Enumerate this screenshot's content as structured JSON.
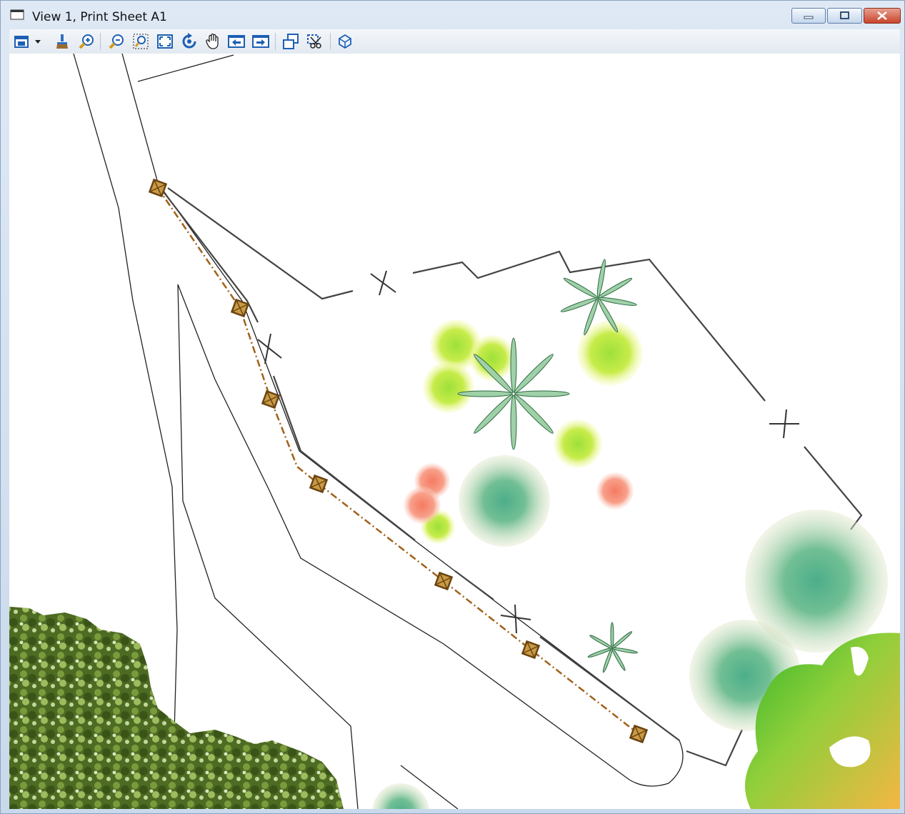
{
  "window": {
    "title": "View 1, Print Sheet A1",
    "controls": {
      "minimize": "minimize",
      "restore": "restore",
      "close": "close"
    }
  },
  "toolbar": {
    "tools": [
      {
        "name": "view-attributes-icon"
      },
      {
        "name": "dropdown-chevron-icon"
      },
      {
        "name": "view-display-style-icon"
      },
      {
        "name": "zoom-in-icon"
      },
      {
        "name": "zoom-out-icon"
      },
      {
        "name": "window-area-icon"
      },
      {
        "name": "fit-view-icon"
      },
      {
        "name": "rotate-view-icon"
      },
      {
        "name": "pan-view-icon"
      },
      {
        "name": "view-previous-icon"
      },
      {
        "name": "view-next-icon"
      },
      {
        "name": "copy-view-icon"
      },
      {
        "name": "clip-volume-icon"
      },
      {
        "name": "view-properties-icon"
      }
    ]
  },
  "colors": {
    "path_line": "#a0611a",
    "node_marker": "#6b4412",
    "linework": "#333333",
    "canvas_bg": "#ffffff"
  }
}
